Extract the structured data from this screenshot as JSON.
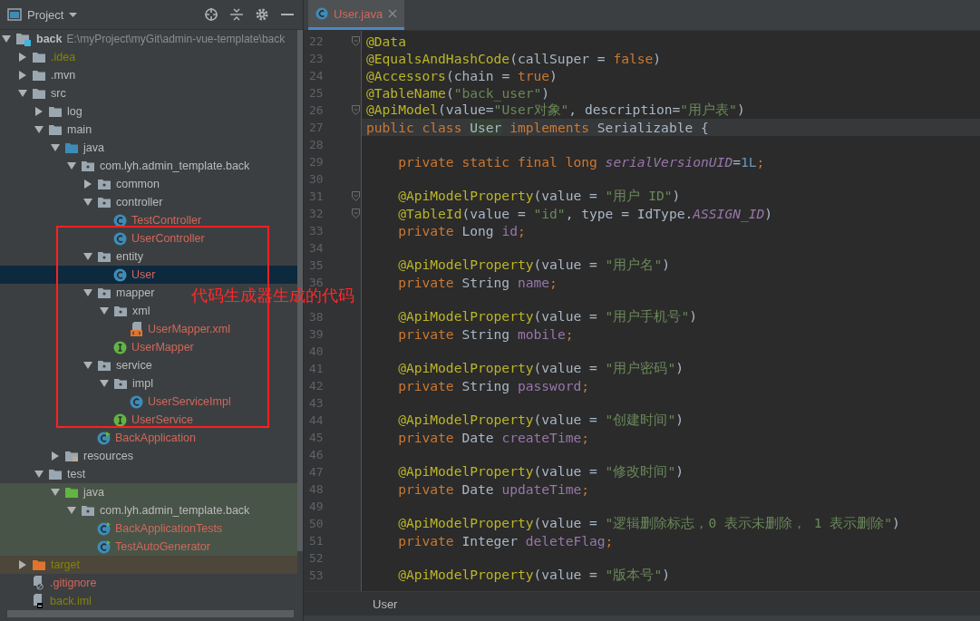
{
  "project_panel": {
    "title": "Project",
    "tree": [
      {
        "name": "back",
        "path": "E:\\myProject\\myGit\\admin-vue-template\\back",
        "kind": "module",
        "color": "#bbbbbb",
        "expanded": true,
        "selected": false,
        "children": [
          {
            "name": ".idea",
            "kind": "folder",
            "color": "#848504",
            "expanded": false,
            "selected": false
          },
          {
            "name": ".mvn",
            "kind": "folder",
            "color": "#bbbbbb",
            "expanded": false,
            "selected": false
          },
          {
            "name": "src",
            "kind": "folder",
            "color": "#bbbbbb",
            "expanded": true,
            "selected": false,
            "children": [
              {
                "name": "log",
                "kind": "folder",
                "color": "#bbbbbb",
                "expanded": false,
                "selected": false
              },
              {
                "name": "main",
                "kind": "folder",
                "color": "#bbbbbb",
                "expanded": true,
                "selected": false,
                "children": [
                  {
                    "name": "java",
                    "kind": "source-folder",
                    "color": "#bbbbbb",
                    "expanded": true,
                    "selected": false,
                    "children": [
                      {
                        "name": "com.lyh.admin_template.back",
                        "kind": "package",
                        "color": "#bbbbbb",
                        "expanded": true,
                        "selected": false,
                        "children": [
                          {
                            "name": "common",
                            "kind": "package",
                            "color": "#bbbbbb",
                            "expanded": false,
                            "selected": false
                          },
                          {
                            "name": "controller",
                            "kind": "package",
                            "color": "#bbbbbb",
                            "expanded": true,
                            "selected": false,
                            "children": [
                              {
                                "name": "TestController",
                                "kind": "class",
                                "color": "#d1675a",
                                "selected": false
                              },
                              {
                                "name": "UserController",
                                "kind": "class",
                                "color": "#d1675a",
                                "selected": false
                              }
                            ]
                          },
                          {
                            "name": "entity",
                            "kind": "package",
                            "color": "#bbbbbb",
                            "expanded": true,
                            "selected": false,
                            "children": [
                              {
                                "name": "User",
                                "kind": "class",
                                "color": "#d1675a",
                                "selected": true
                              }
                            ]
                          },
                          {
                            "name": "mapper",
                            "kind": "package",
                            "color": "#bbbbbb",
                            "expanded": true,
                            "selected": false,
                            "children": [
                              {
                                "name": "xml",
                                "kind": "package",
                                "color": "#bbbbbb",
                                "expanded": true,
                                "selected": false,
                                "children": [
                                  {
                                    "name": "UserMapper.xml",
                                    "kind": "xml",
                                    "color": "#d1675a",
                                    "selected": false
                                  }
                                ]
                              },
                              {
                                "name": "UserMapper",
                                "kind": "interface",
                                "color": "#d1675a",
                                "selected": false
                              }
                            ]
                          },
                          {
                            "name": "service",
                            "kind": "package",
                            "color": "#bbbbbb",
                            "expanded": true,
                            "selected": false,
                            "children": [
                              {
                                "name": "impl",
                                "kind": "package",
                                "color": "#bbbbbb",
                                "expanded": true,
                                "selected": false,
                                "children": [
                                  {
                                    "name": "UserServiceImpl",
                                    "kind": "class",
                                    "color": "#d1675a",
                                    "selected": false
                                  }
                                ]
                              },
                              {
                                "name": "UserService",
                                "kind": "interface",
                                "color": "#d1675a",
                                "selected": false
                              }
                            ]
                          },
                          {
                            "name": "BackApplication",
                            "kind": "app",
                            "color": "#d1675a",
                            "selected": false
                          }
                        ]
                      }
                    ]
                  },
                  {
                    "name": "resources",
                    "kind": "resources-folder",
                    "color": "#bbbbbb",
                    "expanded": false,
                    "selected": false
                  }
                ]
              },
              {
                "name": "test",
                "kind": "folder",
                "color": "#bbbbbb",
                "expanded": true,
                "selected": false,
                "children": [
                  {
                    "name": "java",
                    "kind": "test-folder",
                    "color": "#bbbbbb",
                    "expanded": true,
                    "selected": false,
                    "children": [
                      {
                        "name": "com.lyh.admin_template.back",
                        "kind": "package",
                        "color": "#bbbbbb",
                        "expanded": true,
                        "selected": false,
                        "children": [
                          {
                            "name": "BackApplicationTests",
                            "kind": "test-class",
                            "color": "#d1675a",
                            "selected": false
                          },
                          {
                            "name": "TestAutoGenerator",
                            "kind": "test-class",
                            "color": "#d1675a",
                            "selected": false
                          }
                        ]
                      }
                    ]
                  }
                ]
              }
            ]
          },
          {
            "name": "target",
            "kind": "excluded-folder",
            "color": "#848504",
            "expanded": false,
            "selected": false
          },
          {
            "name": ".gitignore",
            "kind": "gitignore",
            "color": "#d1675a",
            "selected": false
          },
          {
            "name": "back.iml",
            "kind": "iml",
            "color": "#848504",
            "selected": false
          }
        ]
      }
    ]
  },
  "annotation": {
    "text": "代码生成器生成的代码"
  },
  "editor": {
    "tabs": [
      {
        "label": "User.java",
        "color": "#d1675a",
        "selected": true
      }
    ],
    "lines": [
      {
        "number": "22",
        "fold": true,
        "current": false,
        "tokens": [
          {
            "kind": "annotation",
            "text": "@Data"
          }
        ]
      },
      {
        "number": "23",
        "fold": false,
        "current": false,
        "tokens": [
          {
            "kind": "annotation",
            "text": "@EqualsAndHashCode"
          },
          {
            "kind": "plain",
            "text": "(callSuper = "
          },
          {
            "kind": "keyword",
            "text": "false"
          },
          {
            "kind": "plain",
            "text": ")"
          }
        ]
      },
      {
        "number": "24",
        "fold": false,
        "current": false,
        "tokens": [
          {
            "kind": "annotation",
            "text": "@Accessors"
          },
          {
            "kind": "plain",
            "text": "(chain = "
          },
          {
            "kind": "keyword",
            "text": "true"
          },
          {
            "kind": "plain",
            "text": ")"
          }
        ]
      },
      {
        "number": "25",
        "fold": false,
        "current": false,
        "tokens": [
          {
            "kind": "annotation",
            "text": "@TableName"
          },
          {
            "kind": "plain",
            "text": "("
          },
          {
            "kind": "string",
            "text": "\"back_user\""
          },
          {
            "kind": "plain",
            "text": ")"
          }
        ]
      },
      {
        "number": "26",
        "fold": true,
        "current": false,
        "tokens": [
          {
            "kind": "annotation",
            "text": "@ApiModel"
          },
          {
            "kind": "plain",
            "text": "(value="
          },
          {
            "kind": "string",
            "text": "\"User对象\""
          },
          {
            "kind": "plain",
            "text": ", description="
          },
          {
            "kind": "string",
            "text": "\"用户表\""
          },
          {
            "kind": "plain",
            "text": ")"
          }
        ]
      },
      {
        "number": "27",
        "fold": false,
        "current": true,
        "tokens": [
          {
            "kind": "keyword",
            "text": "public class "
          },
          {
            "kind": "match",
            "text": "User"
          },
          {
            "kind": "keyword",
            "text": " implements "
          },
          {
            "kind": "plain",
            "text": "Serializable {"
          }
        ]
      },
      {
        "number": "28",
        "fold": false,
        "current": false
      },
      {
        "number": "29",
        "fold": false,
        "current": false,
        "tokens": [
          {
            "kind": "keyword",
            "text": "    private static final long "
          },
          {
            "kind": "static",
            "text": "serialVersionUID"
          },
          {
            "kind": "plain",
            "text": "="
          },
          {
            "kind": "number",
            "text": "1L"
          },
          {
            "kind": "keyword",
            "text": ";"
          }
        ]
      },
      {
        "number": "30",
        "fold": false,
        "current": false
      },
      {
        "number": "31",
        "fold": true,
        "current": false,
        "tokens": [
          {
            "kind": "annotation",
            "text": "    @ApiModelProperty"
          },
          {
            "kind": "plain",
            "text": "(value = "
          },
          {
            "kind": "string",
            "text": "\"用户 ID\""
          },
          {
            "kind": "plain",
            "text": ")"
          }
        ]
      },
      {
        "number": "32",
        "fold": true,
        "current": false,
        "tokens": [
          {
            "kind": "annotation",
            "text": "    @TableId"
          },
          {
            "kind": "plain",
            "text": "(value = "
          },
          {
            "kind": "string",
            "text": "\"id\""
          },
          {
            "kind": "plain",
            "text": ", type = IdType."
          },
          {
            "kind": "static",
            "text": "ASSIGN_ID"
          },
          {
            "kind": "plain",
            "text": ")"
          }
        ]
      },
      {
        "number": "33",
        "fold": false,
        "current": false,
        "tokens": [
          {
            "kind": "keyword",
            "text": "    private "
          },
          {
            "kind": "plain",
            "text": "Long "
          },
          {
            "kind": "field",
            "text": "id"
          },
          {
            "kind": "keyword",
            "text": ";"
          }
        ]
      },
      {
        "number": "34",
        "fold": false,
        "current": false
      },
      {
        "number": "35",
        "fold": false,
        "current": false,
        "tokens": [
          {
            "kind": "annotation",
            "text": "    @ApiModelProperty"
          },
          {
            "kind": "plain",
            "text": "(value = "
          },
          {
            "kind": "string",
            "text": "\"用户名\""
          },
          {
            "kind": "plain",
            "text": ")"
          }
        ]
      },
      {
        "number": "36",
        "fold": false,
        "current": false,
        "tokens": [
          {
            "kind": "keyword",
            "text": "    private "
          },
          {
            "kind": "plain",
            "text": "String "
          },
          {
            "kind": "field",
            "text": "name"
          },
          {
            "kind": "keyword",
            "text": ";"
          }
        ]
      },
      {
        "fold": false,
        "current": false
      },
      {
        "number": "38",
        "fold": false,
        "current": false,
        "tokens": [
          {
            "kind": "annotation",
            "text": "    @ApiModelProperty"
          },
          {
            "kind": "plain",
            "text": "(value = "
          },
          {
            "kind": "string",
            "text": "\"用户手机号\""
          },
          {
            "kind": "plain",
            "text": ")"
          }
        ]
      },
      {
        "number": "39",
        "fold": false,
        "current": false,
        "tokens": [
          {
            "kind": "keyword",
            "text": "    private "
          },
          {
            "kind": "plain",
            "text": "String "
          },
          {
            "kind": "field",
            "text": "mobile"
          },
          {
            "kind": "keyword",
            "text": ";"
          }
        ]
      },
      {
        "number": "40",
        "fold": false,
        "current": false
      },
      {
        "number": "41",
        "fold": false,
        "current": false,
        "tokens": [
          {
            "kind": "annotation",
            "text": "    @ApiModelProperty"
          },
          {
            "kind": "plain",
            "text": "(value = "
          },
          {
            "kind": "string",
            "text": "\"用户密码\""
          },
          {
            "kind": "plain",
            "text": ")"
          }
        ]
      },
      {
        "number": "42",
        "fold": false,
        "current": false,
        "tokens": [
          {
            "kind": "keyword",
            "text": "    private "
          },
          {
            "kind": "plain",
            "text": "String "
          },
          {
            "kind": "field",
            "text": "password"
          },
          {
            "kind": "keyword",
            "text": ";"
          }
        ]
      },
      {
        "number": "43",
        "fold": false,
        "current": false
      },
      {
        "number": "44",
        "fold": false,
        "current": false,
        "tokens": [
          {
            "kind": "annotation",
            "text": "    @ApiModelProperty"
          },
          {
            "kind": "plain",
            "text": "(value = "
          },
          {
            "kind": "string",
            "text": "\"创建时间\""
          },
          {
            "kind": "plain",
            "text": ")"
          }
        ]
      },
      {
        "number": "45",
        "fold": false,
        "current": false,
        "tokens": [
          {
            "kind": "keyword",
            "text": "    private "
          },
          {
            "kind": "plain",
            "text": "Date "
          },
          {
            "kind": "field",
            "text": "createTime"
          },
          {
            "kind": "keyword",
            "text": ";"
          }
        ]
      },
      {
        "number": "46",
        "fold": false,
        "current": false
      },
      {
        "number": "47",
        "fold": false,
        "current": false,
        "tokens": [
          {
            "kind": "annotation",
            "text": "    @ApiModelProperty"
          },
          {
            "kind": "plain",
            "text": "(value = "
          },
          {
            "kind": "string",
            "text": "\"修改时间\""
          },
          {
            "kind": "plain",
            "text": ")"
          }
        ]
      },
      {
        "number": "48",
        "fold": false,
        "current": false,
        "tokens": [
          {
            "kind": "keyword",
            "text": "    private "
          },
          {
            "kind": "plain",
            "text": "Date "
          },
          {
            "kind": "field",
            "text": "updateTime"
          },
          {
            "kind": "keyword",
            "text": ";"
          }
        ]
      },
      {
        "number": "49",
        "fold": false,
        "current": false
      },
      {
        "number": "50",
        "fold": false,
        "current": false,
        "tokens": [
          {
            "kind": "annotation",
            "text": "    @ApiModelProperty"
          },
          {
            "kind": "plain",
            "text": "(value = "
          },
          {
            "kind": "string",
            "text": "\"逻辑删除标志，0 表示未删除， 1 表示删除\""
          },
          {
            "kind": "plain",
            "text": ")"
          }
        ]
      },
      {
        "number": "51",
        "fold": false,
        "current": false,
        "tokens": [
          {
            "kind": "keyword",
            "text": "    private "
          },
          {
            "kind": "plain",
            "text": "Integer "
          },
          {
            "kind": "field",
            "text": "deleteFlag"
          },
          {
            "kind": "keyword",
            "text": ";"
          }
        ]
      },
      {
        "number": "52",
        "fold": false,
        "current": false
      },
      {
        "number": "53",
        "fold": false,
        "current": false,
        "tokens": [
          {
            "kind": "annotation",
            "text": "    @ApiModelProperty"
          },
          {
            "kind": "plain",
            "text": "(value = "
          },
          {
            "kind": "string",
            "text": "\"版本号\""
          },
          {
            "kind": "plain",
            "text": ")"
          }
        ]
      }
    ],
    "breadcrumb": "User"
  }
}
